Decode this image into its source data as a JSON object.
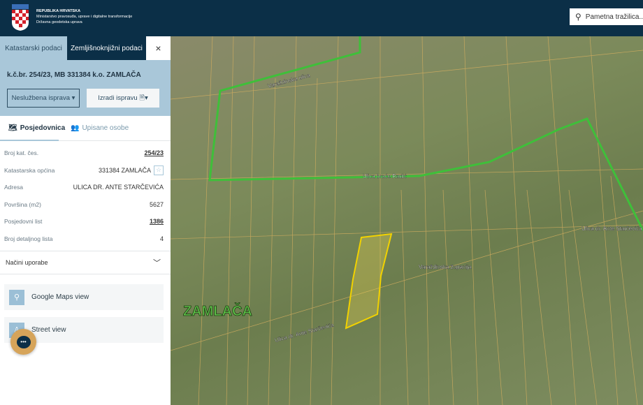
{
  "header": {
    "org_lines": [
      "REPUBLIKA HRVATSKA",
      "Ministarstvo pravosuđa, uprave i digitalne transformacije",
      "Državna geodetska uprava"
    ],
    "search_placeholder": "Pametna tražilica..."
  },
  "sidebar": {
    "tabs": [
      "Katastarski podaci",
      "Zemljišnoknjižni podaci"
    ],
    "close": "×",
    "parcel_title": "k.č.br. 254/23, MB 331384 k.o. ZAMLAČA",
    "buttons": {
      "unofficial": "Neslužbena isprava",
      "create": "Izradi ispravu"
    },
    "subtabs": [
      "Posjedovnica",
      "Upisane osobe"
    ],
    "rows": [
      {
        "label": "Broj kat. čes.",
        "value": "254/23"
      },
      {
        "label": "Katastarska općina",
        "value": "331384 ZAMLAČA"
      },
      {
        "label": "Adresa",
        "value": "ULICA DR. ANTE STARČEVIĆA"
      },
      {
        "label": "Površina (m2)",
        "value": "5627"
      },
      {
        "label": "Posjedovni list",
        "value": "1386"
      },
      {
        "label": "Broj detaljnog lista",
        "value": "4"
      }
    ],
    "accordion": "Načini uporabe",
    "links": [
      "Google Maps view",
      "Street view"
    ]
  },
  "map": {
    "labels": {
      "town": "ZAMLAČA",
      "street1": "Varaždinska ulica",
      "street2": "Ulica braće Radić",
      "street3": "Ulica dr. Ante Starčevića",
      "county": "Varaždinska županija",
      "street4": "Ulica dr. Ante Starčevića"
    },
    "highlight_color": "#f2d200",
    "boundary_color": "#3fbf3a"
  }
}
